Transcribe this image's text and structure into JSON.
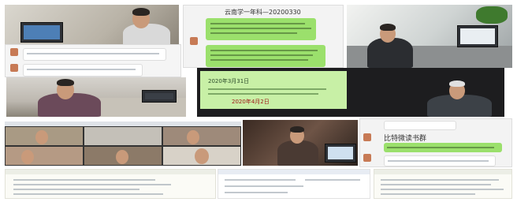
{
  "collage": {
    "chat_top": {
      "title": "云南学一年科—20200330"
    },
    "chat_right": {
      "title": "比特微读书群"
    },
    "projection": {
      "line_1": "2020年3月31日",
      "line_2": "2020年4月2日"
    }
  },
  "palette": {
    "chat_green": "#9be06c",
    "projector_green": "#c8f0a6",
    "background": "#ffffff"
  }
}
